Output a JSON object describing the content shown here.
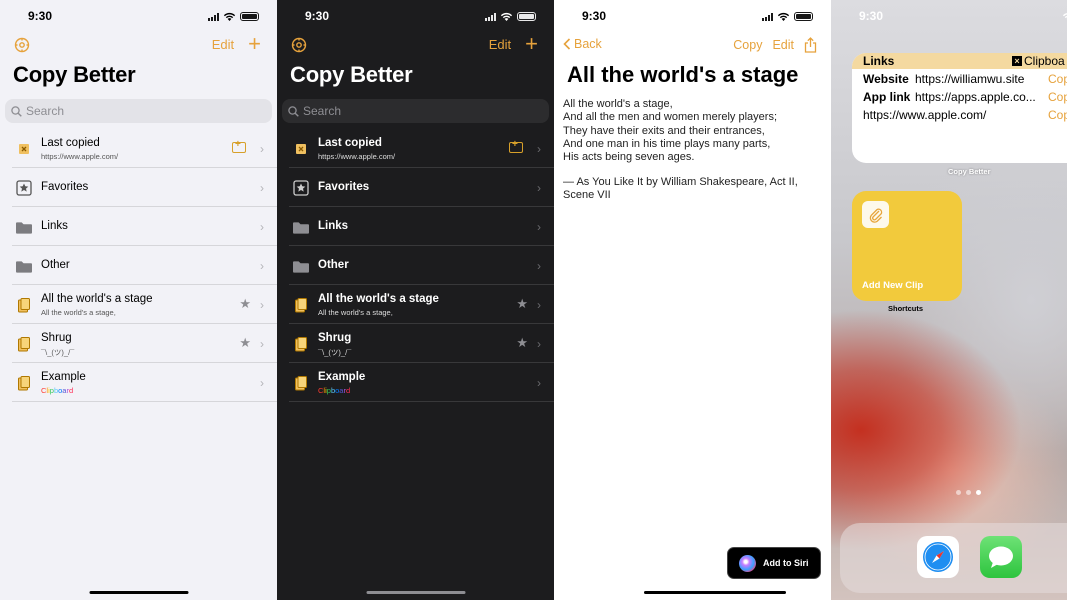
{
  "status": {
    "time": "9:30"
  },
  "list_screen": {
    "title": "Copy Better",
    "edit_label": "Edit",
    "add_icon": "plus-icon",
    "settings_icon": "gear-icon",
    "search_placeholder": "Search",
    "items": [
      {
        "title": "Last copied",
        "subtitle": "https://www.apple.com/",
        "icon": "clipboard-x-icon",
        "accessory": "add-clip-icon"
      },
      {
        "title": "Favorites",
        "subtitle": "",
        "icon": "star-square-icon",
        "accessory": ""
      },
      {
        "title": "Links",
        "subtitle": "",
        "icon": "folder-icon",
        "accessory": ""
      },
      {
        "title": "Other",
        "subtitle": "",
        "icon": "folder-icon",
        "accessory": ""
      },
      {
        "title": "All the world's a stage",
        "subtitle": "All the world's a stage,",
        "icon": "clip-doc-icon",
        "accessory": "star-icon"
      },
      {
        "title": "Shrug",
        "subtitle": "¯\\_(ツ)_/¯",
        "icon": "clip-doc-icon",
        "accessory": "star-icon"
      },
      {
        "title": "Example",
        "subtitle": "Clipboard",
        "icon": "clip-doc-icon",
        "accessory": ""
      }
    ]
  },
  "detail_screen": {
    "back_label": "Back",
    "copy_label": "Copy",
    "edit_label": "Edit",
    "title": "All the world's a stage",
    "body": "All the world's a stage,\nAnd all the men and women merely players;\nThey have their exits and their entrances,\nAnd one man in his time plays many parts,\nHis acts being seven ages.",
    "attribution": "— As You Like It by William Shakespeare, Act II, Scene VII",
    "siri_button": "Add to Siri"
  },
  "home_screen": {
    "widget": {
      "header": "Links",
      "clipboard_label": "Clipboa",
      "rows": [
        {
          "key": "Website",
          "value": "https://williamwu.site",
          "action": "Cop"
        },
        {
          "key": "App link",
          "value": "https://apps.apple.co...",
          "action": "Cop"
        },
        {
          "key": "",
          "value": "https://www.apple.com/",
          "action": "Cop"
        }
      ],
      "caption": "Copy Better"
    },
    "shortcut": {
      "label": "Add New Clip",
      "caption": "Shortcuts"
    },
    "dock_apps": [
      "safari-icon",
      "messages-icon"
    ]
  },
  "colors": {
    "accent": "#e6a23c",
    "widget_header": "#f4d9a0",
    "shortcut_tile": "#f2ca3c"
  }
}
